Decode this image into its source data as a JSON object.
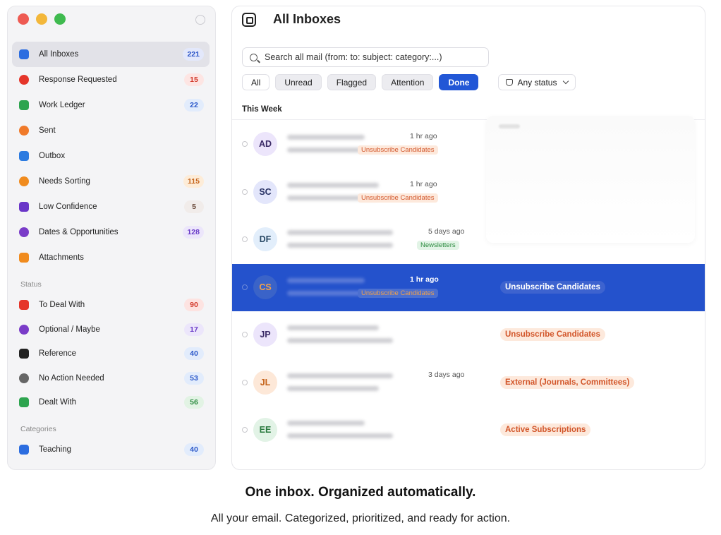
{
  "sidebar": {
    "items": [
      {
        "label": "All Inboxes",
        "count": "221",
        "icon": "inbox-icon",
        "icon_color": "#2c6de0",
        "count_bg": "#e3e8fb",
        "count_fg": "#2c55c8"
      },
      {
        "label": "Response Requested",
        "count": "15",
        "icon": "alert-icon",
        "icon_color": "#e5352a",
        "count_bg": "#fde5e3",
        "count_fg": "#d33a2c"
      },
      {
        "label": "Work Ledger",
        "count": "22",
        "icon": "ledger-icon",
        "icon_color": "#2ea44f",
        "count_bg": "#e2ecfc",
        "count_fg": "#2b58c9"
      },
      {
        "label": "Sent",
        "count": "",
        "icon": "paper-plane-icon",
        "icon_color": "#f07a2a"
      },
      {
        "label": "Outbox",
        "count": "",
        "icon": "outbox-icon",
        "icon_color": "#2c7be0"
      },
      {
        "label": "Needs Sorting",
        "count": "115",
        "icon": "sorting-icon",
        "icon_color": "#f08b1e",
        "count_bg": "#fdecd8",
        "count_fg": "#c5631a"
      },
      {
        "label": "Low Confidence",
        "count": "5",
        "icon": "gauge-icon",
        "icon_color": "#6a36c8",
        "count_bg": "#f1ecea",
        "count_fg": "#6a4a3a"
      },
      {
        "label": "Dates & Opportunities",
        "count": "128",
        "icon": "calendar-icon",
        "icon_color": "#7a3cc8",
        "count_bg": "#ece6fb",
        "count_fg": "#6a3cc8"
      },
      {
        "label": "Attachments",
        "count": "",
        "icon": "paperclip-icon",
        "icon_color": "#f08b1e"
      }
    ],
    "status_title": "Status",
    "status_items": [
      {
        "label": "To Deal With",
        "count": "90",
        "icon": "fire-icon",
        "icon_color": "#e5352a",
        "count_bg": "#fde3e1",
        "count_fg": "#d33a2c"
      },
      {
        "label": "Optional / Maybe",
        "count": "17",
        "icon": "question-icon",
        "icon_color": "#7a3cc8",
        "count_bg": "#ece6fb",
        "count_fg": "#6a3cc8"
      },
      {
        "label": "Reference",
        "count": "40",
        "icon": "book-icon",
        "icon_color": "#222222",
        "count_bg": "#e2ecfc",
        "count_fg": "#2b58c9"
      },
      {
        "label": "No Action Needed",
        "count": "53",
        "icon": "check-circle-icon",
        "icon_color": "#666666",
        "count_bg": "#e2ecfc",
        "count_fg": "#2b58c9"
      },
      {
        "label": "Dealt With",
        "count": "56",
        "icon": "done-icon",
        "icon_color": "#2ea44f",
        "count_bg": "#e2f3e4",
        "count_fg": "#2a8a3e"
      }
    ],
    "categories_title": "Categories",
    "category_items": [
      {
        "label": "Teaching",
        "count": "40",
        "icon": "teaching-icon",
        "icon_color": "#2c6de0",
        "count_bg": "#e2ecfc",
        "count_fg": "#2b58c9"
      }
    ]
  },
  "main": {
    "title": "All Inboxes",
    "search_placeholder": "Search all mail (from: to: subject: category:...)",
    "filters": [
      "All",
      "Unread",
      "Flagged",
      "Attention",
      "Done"
    ],
    "status_select": "Any status",
    "section": "This Week",
    "rows": [
      {
        "initials": "AD",
        "time": "1 hr ago",
        "small_tag": "Unsubscribe Candidates",
        "small_tag_style": "orange",
        "big_tag": "",
        "avatar_bg": "#ece5fb",
        "avatar_fg": "#3a2a66"
      },
      {
        "initials": "SC",
        "time": "1 hr ago",
        "small_tag": "Unsubscribe Candidates",
        "small_tag_style": "orange",
        "big_tag": "",
        "avatar_bg": "#e3e6fb",
        "avatar_fg": "#2a3466"
      },
      {
        "initials": "DF",
        "time": "5 days ago",
        "small_tag": "Newsletters",
        "small_tag_style": "green",
        "big_tag": "",
        "avatar_bg": "#e2eefb",
        "avatar_fg": "#2a4a66"
      },
      {
        "initials": "CS",
        "time": "1 hr ago",
        "small_tag": "Unsubscribe Candidates",
        "small_tag_style": "orange-selected",
        "big_tag": "Unsubscribe Candidates",
        "big_tag_style": "selected",
        "avatar_bg": "#3a63c8",
        "avatar_fg": "#f2a24a",
        "selected": true
      },
      {
        "initials": "JP",
        "time": "",
        "small_tag": "",
        "big_tag": "Unsubscribe Candidates",
        "big_tag_style": "orange",
        "avatar_bg": "#ece5fb",
        "avatar_fg": "#3a2a66"
      },
      {
        "initials": "JL",
        "time": "3 days ago",
        "small_tag": "",
        "big_tag": "External (Journals, Committees)",
        "big_tag_style": "orange",
        "avatar_bg": "#fde8d8",
        "avatar_fg": "#c5631a"
      },
      {
        "initials": "EE",
        "time": "",
        "small_tag": "",
        "big_tag": "Active Subscriptions",
        "big_tag_style": "orange",
        "avatar_bg": "#e2f3e6",
        "avatar_fg": "#2a7a3e"
      }
    ]
  },
  "marketing": {
    "headline": "One inbox. Organized automatically.",
    "subhead": "All your email. Categorized, prioritized, and ready for action."
  }
}
